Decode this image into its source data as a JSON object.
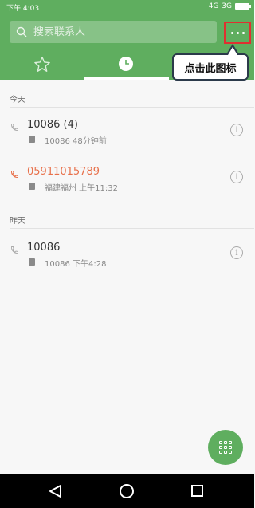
{
  "status_bar": {
    "time": "下午 4:03",
    "network_1": "4G",
    "network_2": "3G"
  },
  "search": {
    "placeholder": "搜索联系人"
  },
  "annotation": {
    "callout_text": "点击此图标"
  },
  "tabs": [
    {
      "name": "favorites",
      "icon": "star-icon",
      "selected": false
    },
    {
      "name": "recent",
      "icon": "clock-icon",
      "selected": true
    }
  ],
  "call_log": {
    "sections": [
      {
        "label": "今天",
        "calls": [
          {
            "name": "10086",
            "count": "(4)",
            "detail": "10086 48分钟前",
            "missed": false
          },
          {
            "name": "05911015789",
            "count": "",
            "detail": "福建福州 上午11:32",
            "missed": true
          }
        ]
      },
      {
        "label": "昨天",
        "calls": [
          {
            "name": "10086",
            "count": "",
            "detail": "10086 下午4:28",
            "missed": false
          }
        ]
      }
    ]
  },
  "colors": {
    "header_green": "#5fae5f",
    "missed_orange": "#e8704a",
    "highlight_red": "#e03030"
  }
}
